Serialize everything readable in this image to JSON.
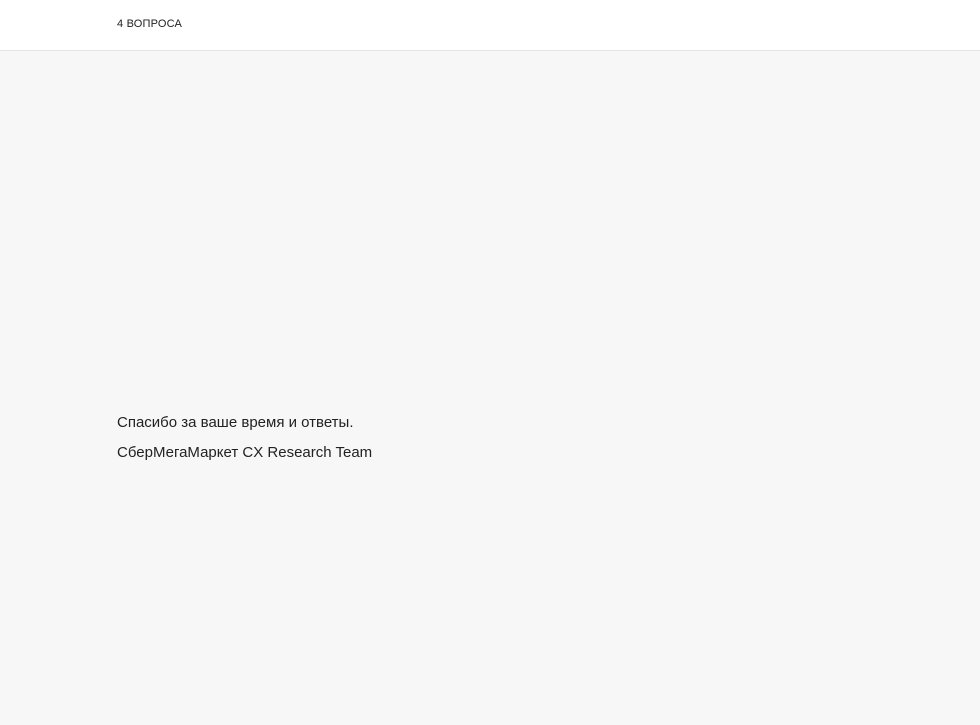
{
  "header": {
    "question_count": "4 ВОПРОСА"
  },
  "completion": {
    "thanks_text": "Спасибо за ваше время и ответы.",
    "signature_text": "СберМегаМаркет CX Research Team"
  },
  "colors": {
    "header_background": "#ffffff",
    "page_background": "#f7f7f7",
    "text": "#222222",
    "divider": "#e4e4e4"
  }
}
